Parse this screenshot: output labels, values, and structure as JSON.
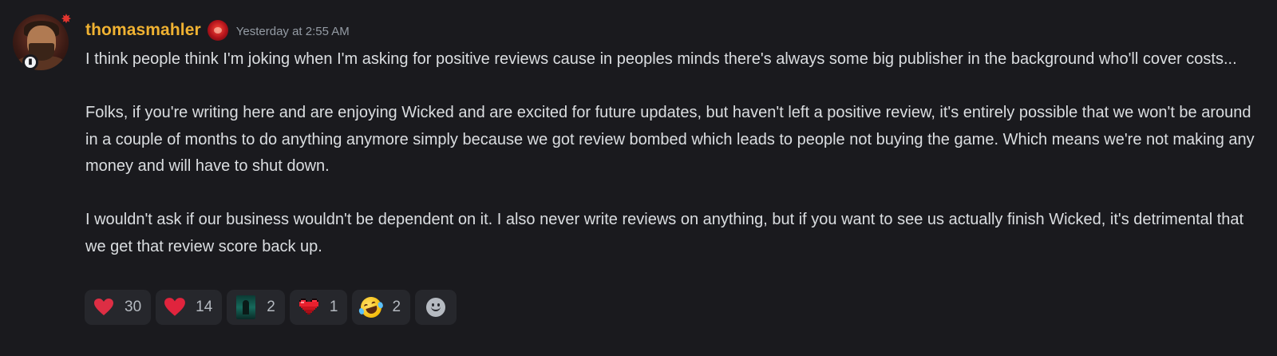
{
  "message": {
    "author": "thomasmahler",
    "timestamp": "Yesterday at 2:55 AM",
    "paragraphs": [
      "I think people think I'm joking when I'm asking for positive reviews cause in peoples minds there's always some big publisher in the background who'll cover costs...",
      "Folks, if you're writing here and are enjoying Wicked and are excited for future updates, but haven't left a positive review, it's entirely possible that we won't be around in a couple of months to do anything anymore simply because we got review bombed which leads to people not buying the game. Which means we're not making any money and will have to shut down.",
      "I wouldn't ask if our business wouldn't be dependent on it. I also never write reviews on anything, but if you want to see us actually finish Wicked, it's detrimental that we get that review score back up."
    ]
  },
  "reactions": [
    {
      "emoji": "red-heart-icon",
      "count": "30"
    },
    {
      "emoji": "heart-icon",
      "count": "14"
    },
    {
      "emoji": "custom-dark-figure-icon",
      "count": "2"
    },
    {
      "emoji": "pixel-heart-icon",
      "count": "1"
    },
    {
      "emoji": "rolling-laughing-icon",
      "count": "2"
    }
  ],
  "colors": {
    "background": "#1a1a1e",
    "username": "#f0b232",
    "text": "#dbdee1",
    "timestamp": "#949ba4",
    "reaction_bg": "#26272c"
  }
}
